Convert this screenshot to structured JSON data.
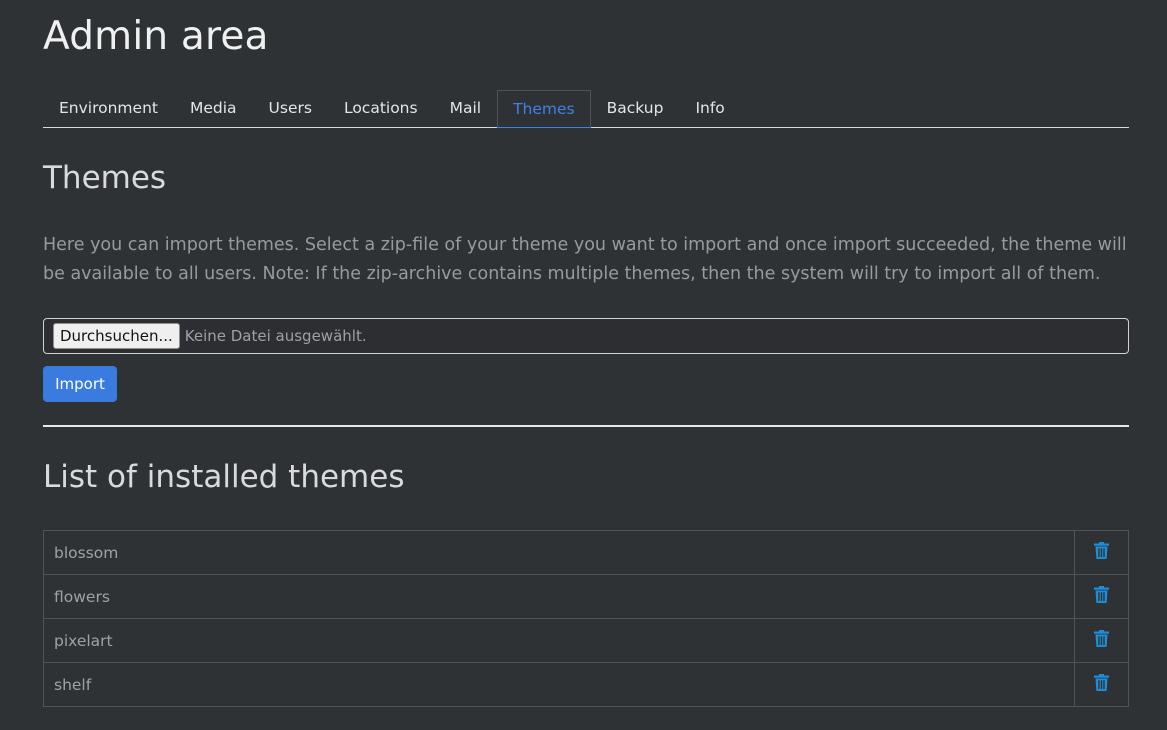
{
  "header": {
    "title": "Admin area"
  },
  "tabs": [
    {
      "label": "Environment",
      "active": false
    },
    {
      "label": "Media",
      "active": false
    },
    {
      "label": "Users",
      "active": false
    },
    {
      "label": "Locations",
      "active": false
    },
    {
      "label": "Mail",
      "active": false
    },
    {
      "label": "Themes",
      "active": true
    },
    {
      "label": "Backup",
      "active": false
    },
    {
      "label": "Info",
      "active": false
    }
  ],
  "themes_section": {
    "title": "Themes",
    "description": "Here you can import themes. Select a zip-file of your theme you want to import and once import succeeded, the theme will be available to all users. Note: If the zip-archive contains multiple themes, then the system will try to import all of them.",
    "file_input": {
      "button_label": "Durchsuchen...",
      "status": "Keine Datei ausgewählt."
    },
    "import_label": "Import"
  },
  "installed": {
    "title": "List of installed themes",
    "themes": [
      {
        "name": "blossom",
        "action_icon": "trash-icon"
      },
      {
        "name": "flowers",
        "action_icon": "trash-icon"
      },
      {
        "name": "pixelart",
        "action_icon": "trash-icon"
      },
      {
        "name": "shelf",
        "action_icon": "trash-icon"
      }
    ]
  },
  "colors": {
    "background": "#2f3235",
    "accent": "#3a7be0",
    "active_tab": "#3e82e6",
    "trash_icon": "#1f8ed8"
  }
}
